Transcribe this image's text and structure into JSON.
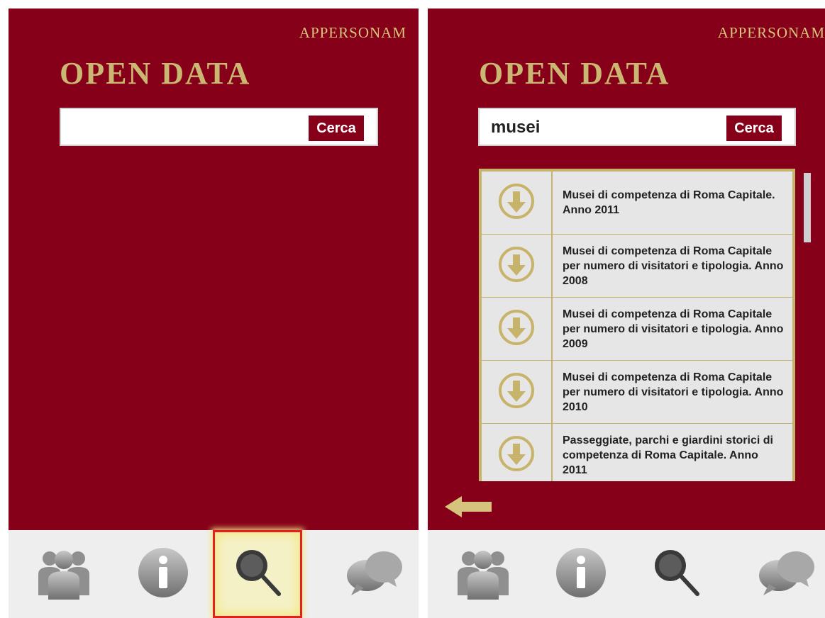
{
  "left_screen": {
    "brand": "APPERSONAM",
    "title": "OPEN DATA",
    "search": {
      "value": "",
      "button_label": "Cerca"
    },
    "tabs": [
      {
        "icon": "users-icon",
        "selected": false
      },
      {
        "icon": "info-icon",
        "selected": false
      },
      {
        "icon": "search-icon",
        "selected": true
      },
      {
        "icon": "chat-icon",
        "selected": false
      }
    ]
  },
  "right_screen": {
    "brand": "APPERSONAM",
    "title": "OPEN DATA",
    "search": {
      "value": "musei",
      "button_label": "Cerca"
    },
    "results": [
      {
        "icon": "download-icon",
        "text": "Musei di competenza di Roma Capitale. Anno 2011"
      },
      {
        "icon": "download-icon",
        "text": "Musei di competenza di Roma Capitale per numero di visitatori e tipologia. Anno 2008"
      },
      {
        "icon": "download-icon",
        "text": "Musei di competenza di Roma Capitale per numero di visitatori e tipologia. Anno 2009"
      },
      {
        "icon": "download-icon",
        "text": "Musei di competenza di Roma Capitale per numero di visitatori e tipologia. Anno 2010"
      },
      {
        "icon": "download-icon",
        "text": "Passeggiate, parchi e giardini storici di competenza di Roma Capitale. Anno 2011"
      }
    ],
    "back_icon": "back-arrow-icon",
    "tabs": [
      {
        "icon": "users-icon",
        "selected": false
      },
      {
        "icon": "info-icon",
        "selected": false
      },
      {
        "icon": "search-icon",
        "selected": false
      },
      {
        "icon": "chat-icon",
        "selected": false
      }
    ]
  },
  "colors": {
    "background": "#850018",
    "gold": "#c9b772",
    "tab_bar": "#eeeeee",
    "selection_border": "#e31f1f"
  }
}
